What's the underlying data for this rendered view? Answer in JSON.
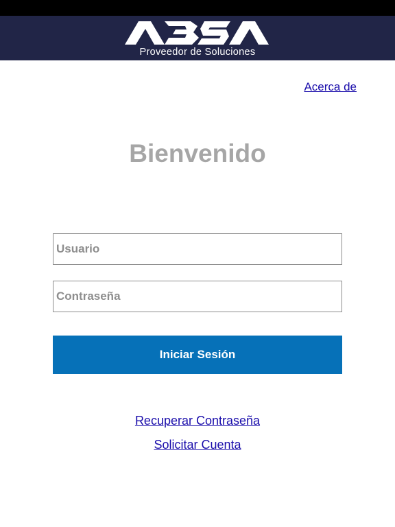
{
  "header": {
    "logo_text": "ABSA",
    "tagline": "Proveedor de Soluciones",
    "background": "#212547"
  },
  "top_link": {
    "about_label": "Acerca de"
  },
  "main": {
    "title": "Bienvenido"
  },
  "form": {
    "username": {
      "placeholder": "Usuario",
      "value": ""
    },
    "password": {
      "placeholder": "Contraseña",
      "value": ""
    },
    "submit_label": "Iniciar Sesión",
    "submit_color": "#0671b8"
  },
  "links": {
    "recover_password": "Recuperar Contraseña",
    "request_account": "Solicitar Cuenta",
    "link_color": "#1a0dab"
  }
}
